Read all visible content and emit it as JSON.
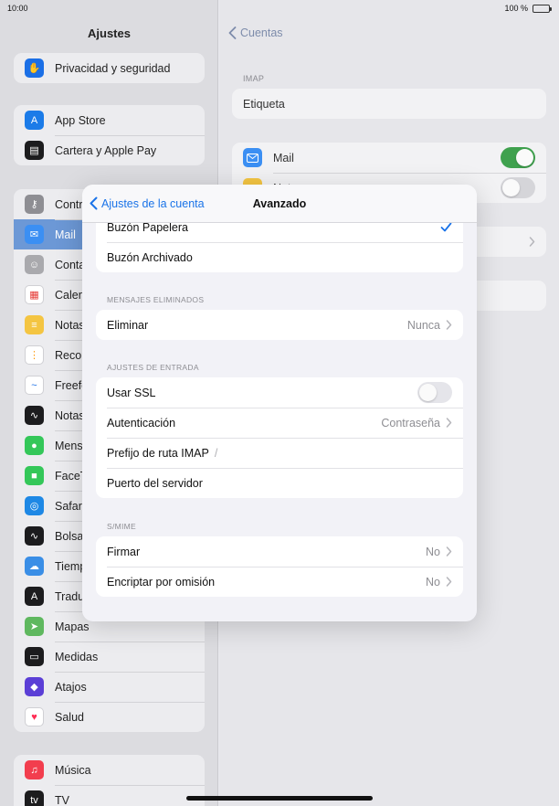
{
  "status_bar": {
    "time": "10:00",
    "battery_percent": "100 %",
    "battery_level": 1.0
  },
  "sidebar": {
    "title": "Ajustes",
    "groups": [
      {
        "items": [
          {
            "label": "Privacidad y seguridad",
            "icon": "hand-icon",
            "color": "#1b6fe6"
          }
        ]
      },
      {
        "items": [
          {
            "label": "App Store",
            "icon": "appstore-icon",
            "color": "#1b7be8"
          },
          {
            "label": "Cartera y Apple Pay",
            "icon": "wallet-icon",
            "color": "#1c1c1e"
          }
        ]
      },
      {
        "items": [
          {
            "label": "Contr",
            "icon": "key-icon",
            "color": "#8e8e93"
          },
          {
            "label": "Mail",
            "icon": "mail-icon",
            "color": "#3b8ff3",
            "selected": true
          },
          {
            "label": "Conta",
            "icon": "contacts-icon",
            "color": "#a9a9ad"
          },
          {
            "label": "Calen",
            "icon": "calendar-icon",
            "color": "#ffffff"
          },
          {
            "label": "Notas",
            "icon": "notes-icon",
            "color": "#f4c542"
          },
          {
            "label": "Recor",
            "icon": "reminders-icon",
            "color": "#ffffff"
          },
          {
            "label": "Freefo",
            "icon": "freeform-icon",
            "color": "#ffffff"
          },
          {
            "label": "Notas",
            "icon": "voice-memos-icon",
            "color": "#1c1c1e"
          },
          {
            "label": "Mens",
            "icon": "messages-icon",
            "color": "#34c759"
          },
          {
            "label": "FaceT",
            "icon": "facetime-icon",
            "color": "#34c759"
          },
          {
            "label": "Safar",
            "icon": "safari-icon",
            "color": "#1e88e5"
          },
          {
            "label": "Bolsa",
            "icon": "stocks-icon",
            "color": "#1c1c1e"
          },
          {
            "label": "Tiemp",
            "icon": "weather-icon",
            "color": "#3a8ee6"
          },
          {
            "label": "Tradu",
            "icon": "translate-icon",
            "color": "#1c1c1e"
          },
          {
            "label": "Mapas",
            "icon": "maps-icon",
            "color": "#5fb85f"
          },
          {
            "label": "Medidas",
            "icon": "measure-icon",
            "color": "#1c1c1e"
          },
          {
            "label": "Atajos",
            "icon": "shortcuts-icon",
            "color": "#5b3fd6"
          },
          {
            "label": "Salud",
            "icon": "heart-icon",
            "color": "#ffffff"
          }
        ]
      },
      {
        "items": [
          {
            "label": "Música",
            "icon": "music-icon",
            "color": "#f23e4e"
          },
          {
            "label": "TV",
            "icon": "tv-icon",
            "color": "#1c1c1e"
          }
        ]
      }
    ]
  },
  "detail": {
    "back_label": "Cuentas",
    "section_label": "IMAP",
    "account_label": "Etiqueta",
    "services": [
      {
        "label": "Mail",
        "icon": "mail-icon",
        "on": true
      },
      {
        "label": "Not",
        "icon": "notes-icon",
        "on": false
      }
    ]
  },
  "modal": {
    "back_label": "Ajustes de la cuenta",
    "title": "Avanzado",
    "mailbox_rows": [
      {
        "label": "Buzón Papelera",
        "checked": true
      },
      {
        "label": "Buzón Archivado",
        "checked": false
      }
    ],
    "deleted_section": "MENSAJES ELIMINADOS",
    "deleted_rows": [
      {
        "label": "Eliminar",
        "value": "Nunca"
      }
    ],
    "incoming_section": "AJUSTES DE ENTRADA",
    "incoming_rows": {
      "ssl": {
        "label": "Usar SSL",
        "on": false
      },
      "auth": {
        "label": "Autenticación",
        "value": "Contraseña"
      },
      "prefix": {
        "label": "Prefijo de ruta IMAP",
        "value": "/"
      },
      "port": {
        "label": "Puerto del servidor",
        "value": ""
      }
    },
    "smime_section": "S/MIME",
    "smime_rows": [
      {
        "label": "Firmar",
        "value": "No"
      },
      {
        "label": "Encriptar por omisión",
        "value": "No"
      }
    ]
  },
  "colors": {
    "accent": "#1a73e8",
    "toggle_on": "#34c759",
    "selected_sidebar": "#6c98d6"
  }
}
